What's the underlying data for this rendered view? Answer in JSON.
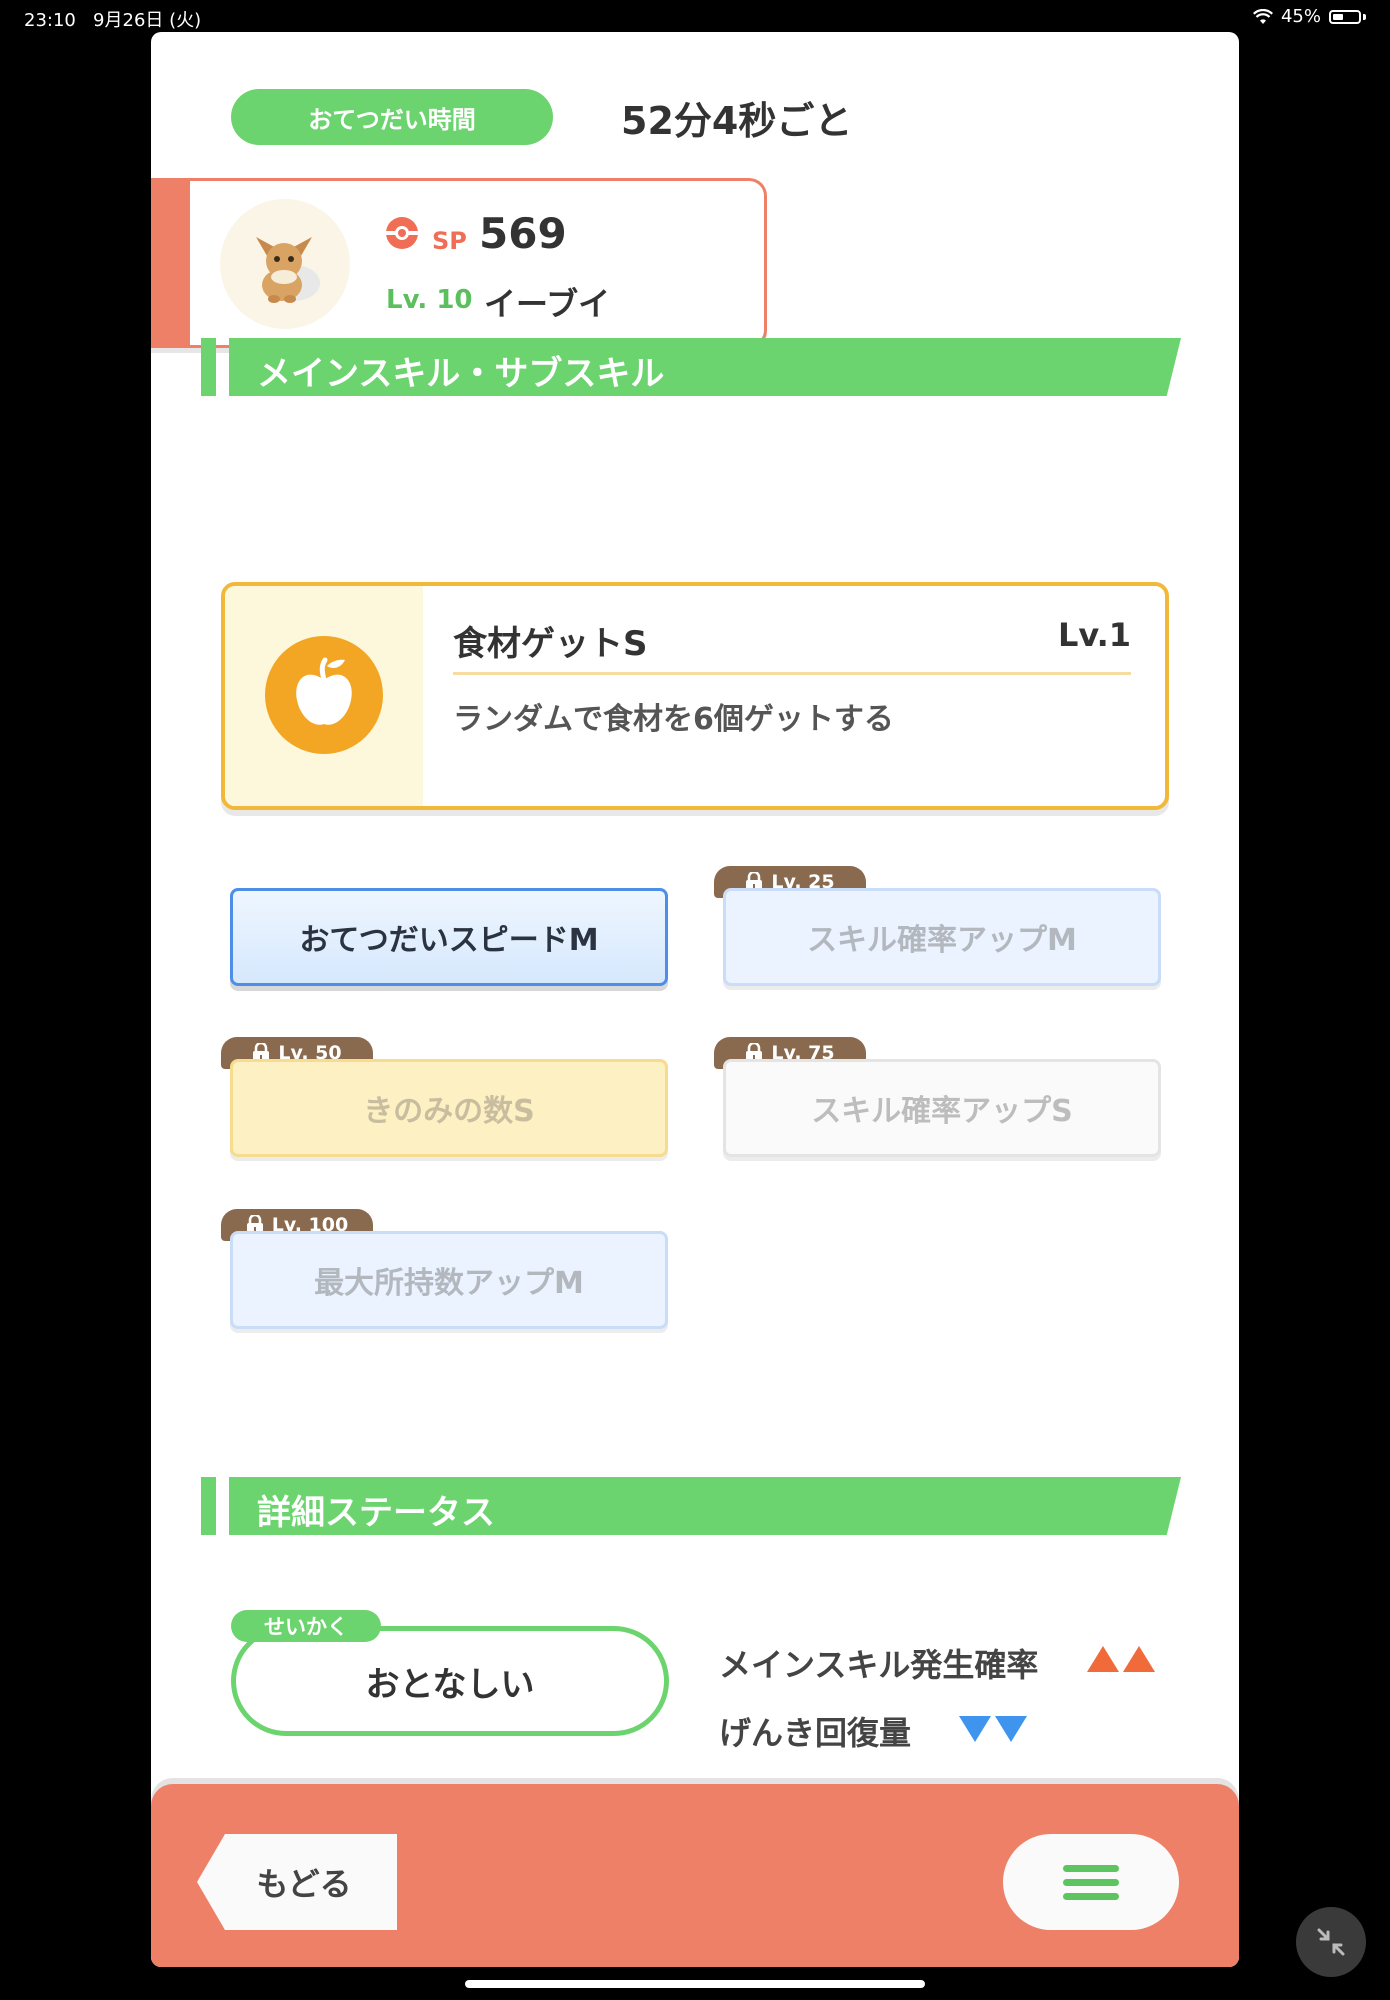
{
  "status_bar": {
    "time": "23:10",
    "date": "9月26日 (火)",
    "battery": "45%"
  },
  "help": {
    "label": "おてつだい時間",
    "value": "52分4秒ごと"
  },
  "pokemon": {
    "sp_label": "SP",
    "sp_value": "569",
    "level": "Lv. 10",
    "name": "イーブイ"
  },
  "sections": {
    "skills_title": "メインスキル・サブスキル",
    "details_title": "詳細ステータス"
  },
  "main_skill": {
    "name": "食材ゲットS",
    "level": "Lv.1",
    "description": "ランダムで食材を6個ゲットする",
    "icon": "apple-icon"
  },
  "sub_skills": [
    {
      "label": "おてつだいスピードM",
      "lock": ""
    },
    {
      "label": "スキル確率アップM",
      "lock": "Lv. 25"
    },
    {
      "label": "きのみの数S",
      "lock": "Lv. 50"
    },
    {
      "label": "スキル確率アップS",
      "lock": "Lv. 75"
    },
    {
      "label": "最大所持数アップM",
      "lock": "Lv. 100"
    }
  ],
  "nature": {
    "tag": "せいかく",
    "value": "おとなしい",
    "effects": [
      {
        "label": "メインスキル発生確率",
        "direction": "up"
      },
      {
        "label": "げんき回復量",
        "direction": "down"
      }
    ]
  },
  "footer": {
    "back_label": "もどる",
    "menu_icon": "hamburger-menu-icon"
  },
  "colors": {
    "accent_green": "#6cd46f",
    "accent_coral": "#ef8068",
    "skill_gold": "#f1b83a",
    "up_arrow": "#f06a3a",
    "down_arrow": "#3f94ee"
  }
}
